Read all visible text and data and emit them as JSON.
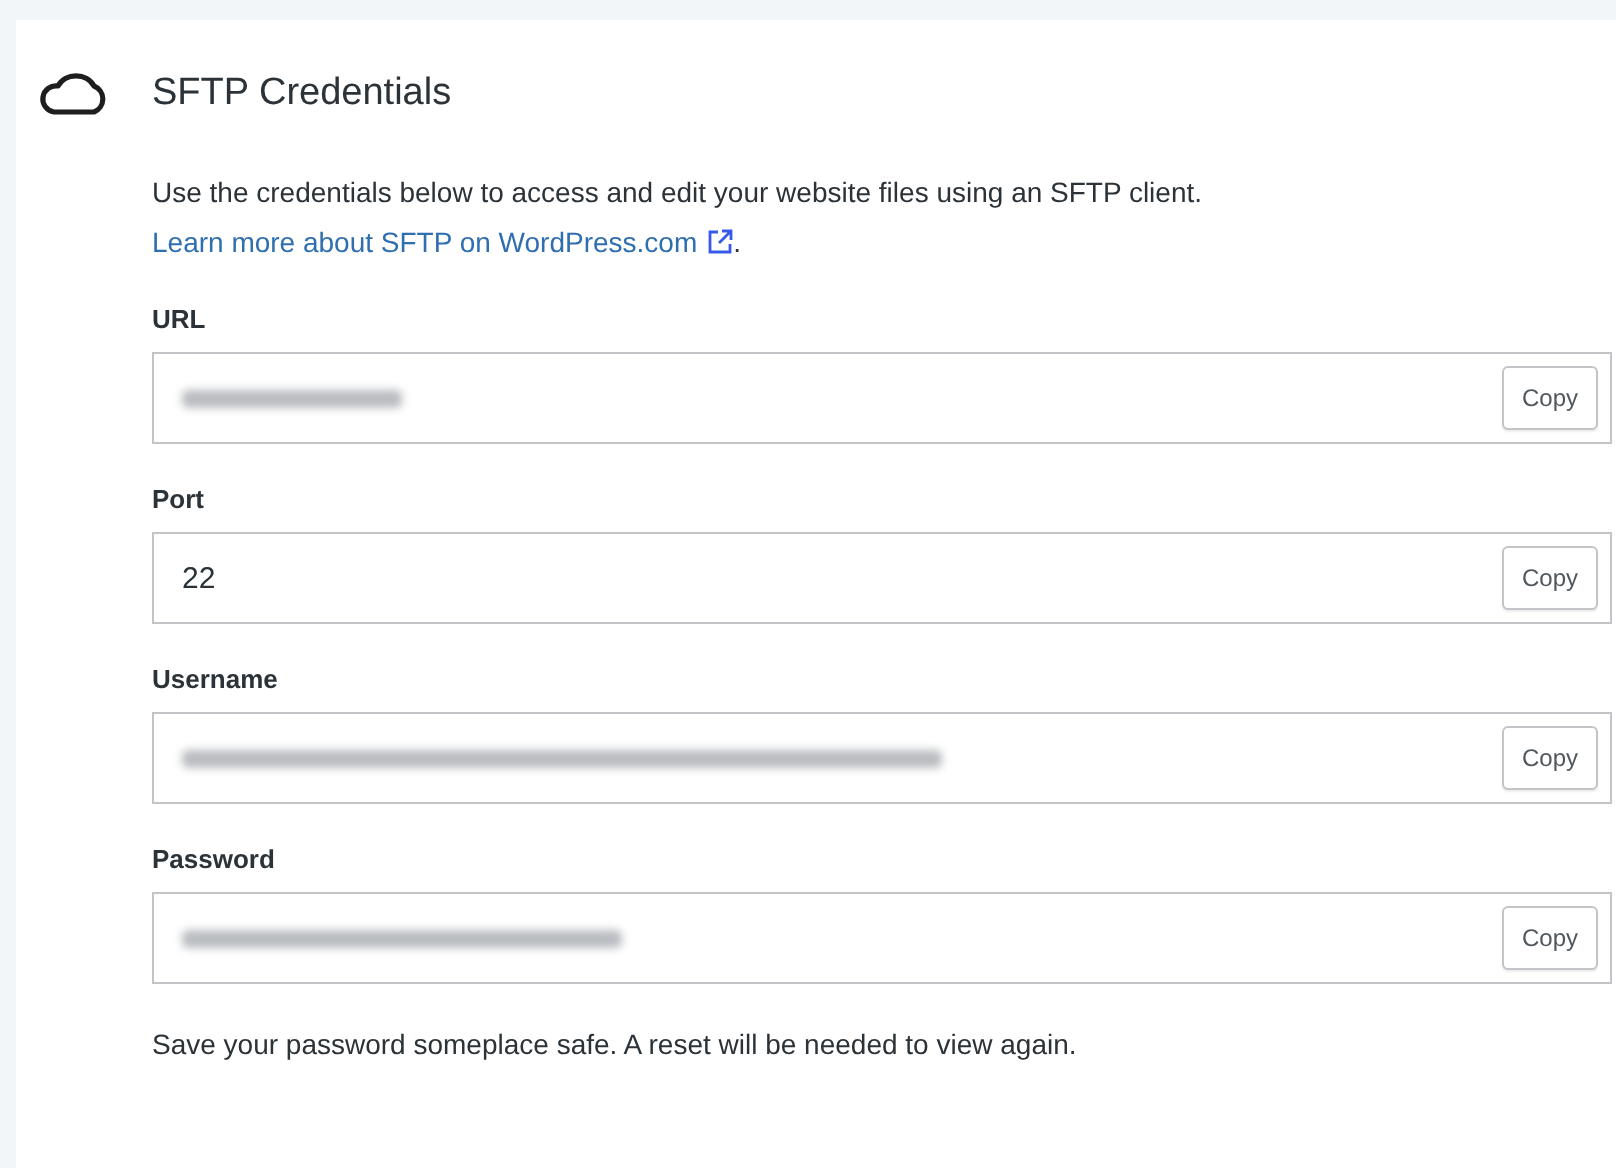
{
  "section": {
    "title": "SFTP Credentials",
    "description": "Use the credentials below to access and edit your website files using an SFTP client. ",
    "link": "Learn more about SFTP on WordPress.com",
    "after_link": "."
  },
  "fields": [
    {
      "label": "URL",
      "masked": true,
      "button": "Copy"
    },
    {
      "label": "Port",
      "masked": false,
      "value": "22",
      "button": "Copy"
    },
    {
      "label": "Username",
      "masked": true,
      "button": "Copy"
    },
    {
      "label": "Password",
      "masked": true,
      "button": "Copy"
    }
  ],
  "note": "Save your password someplace safe. A reset will be needed to view again."
}
